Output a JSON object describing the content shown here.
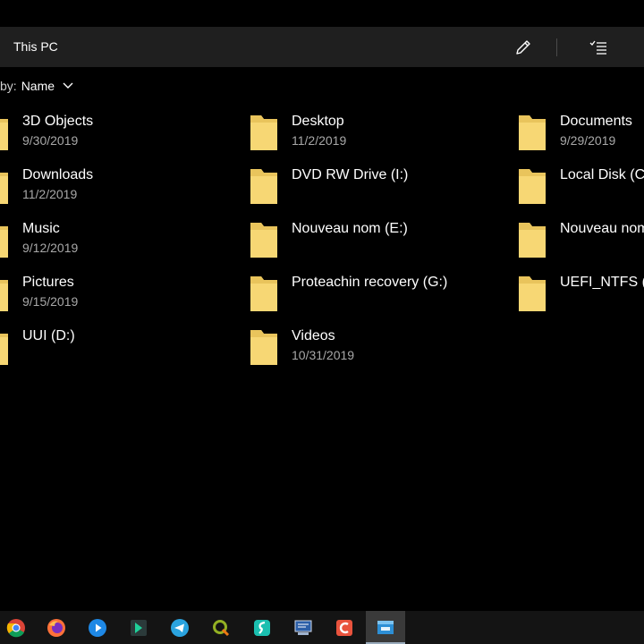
{
  "window": {
    "title": "This PC",
    "edit_icon": "pencil-icon",
    "select_icon": "checklist-icon"
  },
  "sort": {
    "prefix": "by:",
    "value": "Name",
    "chevron_icon": "chevron-down-icon"
  },
  "items": [
    {
      "name": "3D Objects",
      "date": "9/30/2019"
    },
    {
      "name": "Desktop",
      "date": "11/2/2019"
    },
    {
      "name": "Documents",
      "date": "9/29/2019"
    },
    {
      "name": "Downloads",
      "date": "11/2/2019"
    },
    {
      "name": "DVD RW Drive (I:)",
      "date": ""
    },
    {
      "name": "Local Disk (C:",
      "date": ""
    },
    {
      "name": "Music",
      "date": "9/12/2019"
    },
    {
      "name": "Nouveau nom (E:)",
      "date": ""
    },
    {
      "name": "Nouveau nom",
      "date": ""
    },
    {
      "name": "Pictures",
      "date": "9/15/2019"
    },
    {
      "name": "Proteachin recovery (G:)",
      "date": ""
    },
    {
      "name": "UEFI_NTFS (F",
      "date": ""
    },
    {
      "name": "UUI (D:)",
      "date": ""
    },
    {
      "name": "Videos",
      "date": "10/31/2019"
    }
  ],
  "colors": {
    "folder": "#f7d774",
    "background": "#000000",
    "titlebar": "#1f1f1f"
  },
  "taskbar": {
    "apps": [
      "chrome-icon",
      "firefox-icon",
      "media-player-icon",
      "kite-app-icon",
      "telegram-icon",
      "qgis-icon",
      "surfshark-icon",
      "network-tool-icon",
      "camtasia-icon",
      "file-explorer-icon"
    ],
    "active": "file-explorer-icon"
  }
}
